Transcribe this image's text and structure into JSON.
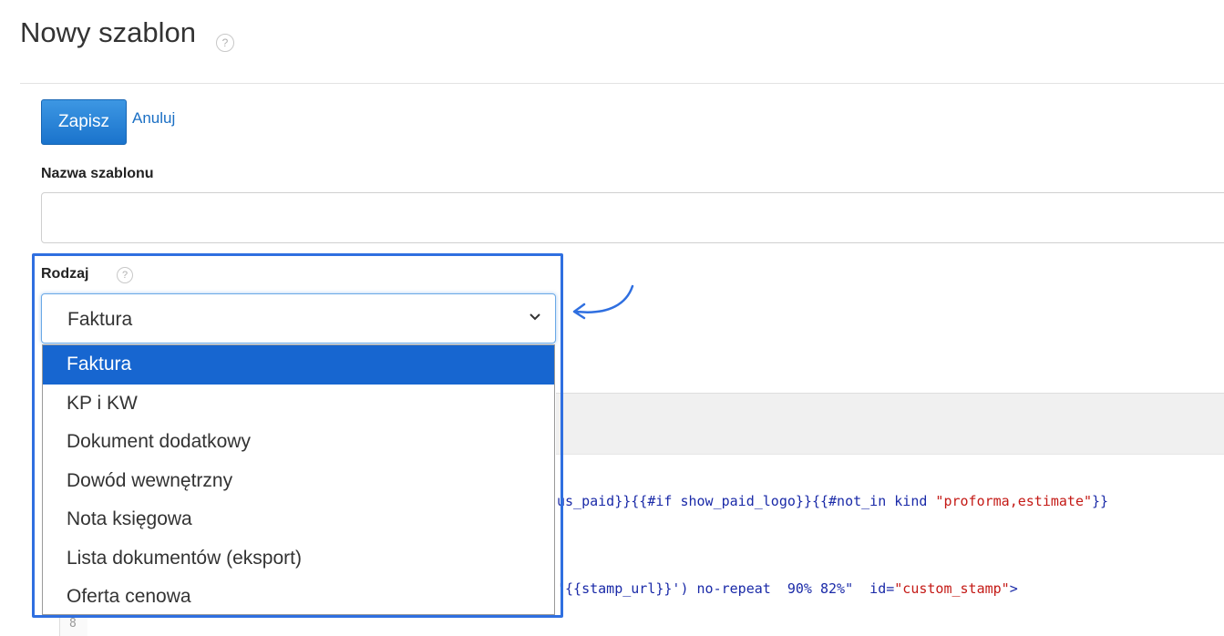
{
  "page": {
    "title": "Nowy szablon",
    "help_glyph": "?"
  },
  "toolbar": {
    "save_label": "Zapisz",
    "cancel_label": "Anuluj"
  },
  "form": {
    "name_label": "Nazwa szablonu",
    "name_value": "",
    "kind_label": "Rodzaj",
    "kind_selected": "Faktura",
    "kind_options": [
      "Faktura",
      "KP i KW",
      "Dokument dodatkowy",
      "Dowód wewnętrzny",
      "Nota księgowa",
      "Lista dokumentów (eksport)",
      "Oferta cenowa"
    ]
  },
  "editor": {
    "line1": {
      "a": "us_paid}}{{#if show_paid_logo}}{{#not_in kind ",
      "b": "\"proforma,estimate\"",
      "c": "}}"
    },
    "line2": {
      "a": "'{{stamp_url}}') no-repeat  90% 82%\"  ",
      "b": "id=",
      "c": "\"custom_stamp\"",
      "d": ">"
    },
    "gutter_number": "8"
  },
  "colors": {
    "accent": "#1766d0",
    "highlight_border": "#2f6fe0",
    "link": "#1a6fc4"
  }
}
